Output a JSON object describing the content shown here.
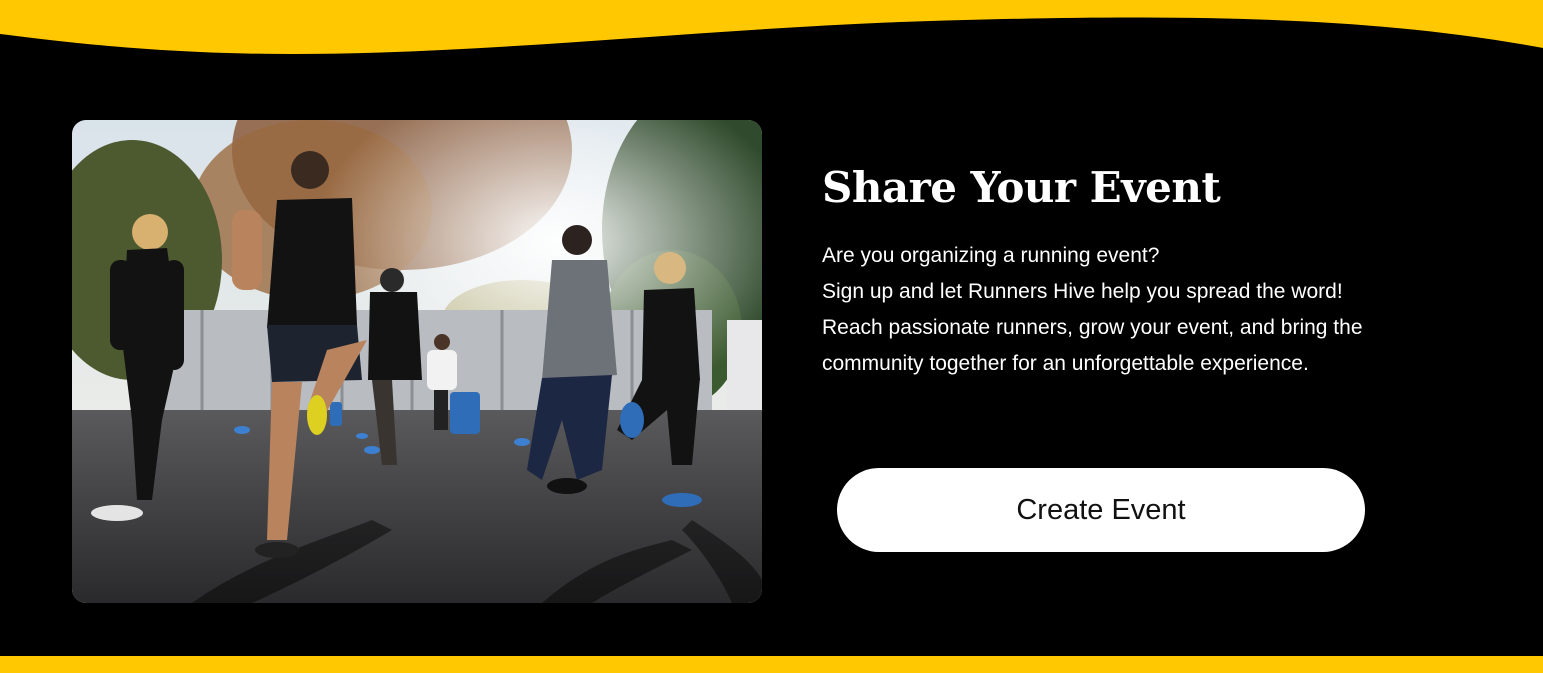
{
  "theme": {
    "accent": "#FFC800",
    "background": "#000000",
    "button_bg": "#FFFFFF",
    "text": "#FFFFFF"
  },
  "event_section": {
    "image_icon": "photo-runners-group-training",
    "title": "Share Your Event",
    "description_lines": [
      "Are you organizing a running event?",
      "Sign up and let Runners Hive help you spread the word! Reach passionate runners, grow your event, and bring the community together for an unforgettable experience."
    ],
    "cta_label": "Create Event"
  }
}
